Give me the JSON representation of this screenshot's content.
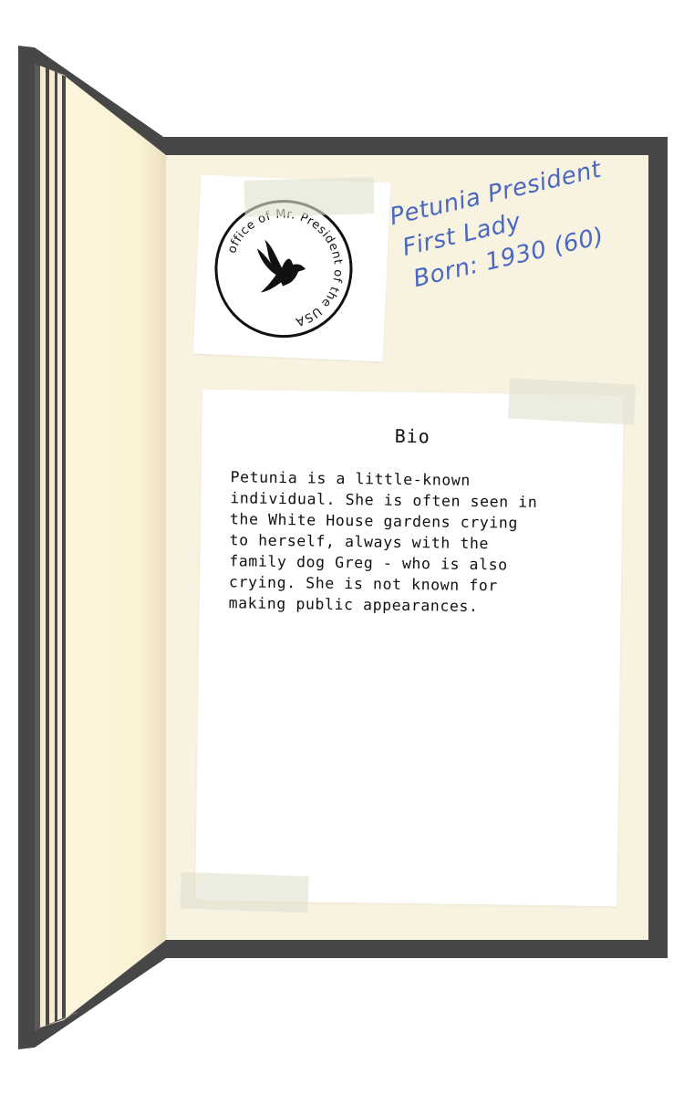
{
  "seal": {
    "ring_text": "office of Mr. President of the USA",
    "emblem": "dove-icon"
  },
  "profile": {
    "name": "Petunia President",
    "role": "First Lady",
    "born": "Born: 1930 (60)"
  },
  "bio": {
    "title": "Bio",
    "text": "Petunia is a little-known\nindividual. She is often seen in\nthe White House gardens crying\nto herself, always with the\nfamily dog Greg - who is also\ncrying. She is not known for\nmaking public appearances."
  },
  "colors": {
    "cover": "#474747",
    "page": "#f8f2e1",
    "ink": "#4a68c0"
  }
}
